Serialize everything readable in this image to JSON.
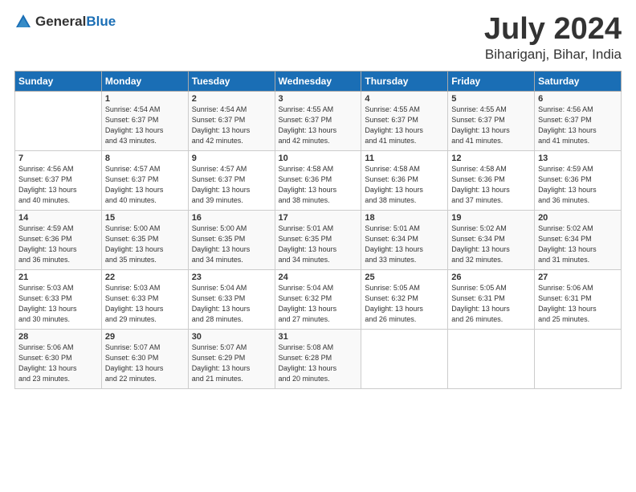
{
  "logo": {
    "text_general": "General",
    "text_blue": "Blue"
  },
  "header": {
    "month": "July 2024",
    "location": "Bihariganj, Bihar, India"
  },
  "weekdays": [
    "Sunday",
    "Monday",
    "Tuesday",
    "Wednesday",
    "Thursday",
    "Friday",
    "Saturday"
  ],
  "weeks": [
    [
      {
        "day": "",
        "info": ""
      },
      {
        "day": "1",
        "info": "Sunrise: 4:54 AM\nSunset: 6:37 PM\nDaylight: 13 hours\nand 43 minutes."
      },
      {
        "day": "2",
        "info": "Sunrise: 4:54 AM\nSunset: 6:37 PM\nDaylight: 13 hours\nand 42 minutes."
      },
      {
        "day": "3",
        "info": "Sunrise: 4:55 AM\nSunset: 6:37 PM\nDaylight: 13 hours\nand 42 minutes."
      },
      {
        "day": "4",
        "info": "Sunrise: 4:55 AM\nSunset: 6:37 PM\nDaylight: 13 hours\nand 41 minutes."
      },
      {
        "day": "5",
        "info": "Sunrise: 4:55 AM\nSunset: 6:37 PM\nDaylight: 13 hours\nand 41 minutes."
      },
      {
        "day": "6",
        "info": "Sunrise: 4:56 AM\nSunset: 6:37 PM\nDaylight: 13 hours\nand 41 minutes."
      }
    ],
    [
      {
        "day": "7",
        "info": "Sunrise: 4:56 AM\nSunset: 6:37 PM\nDaylight: 13 hours\nand 40 minutes."
      },
      {
        "day": "8",
        "info": "Sunrise: 4:57 AM\nSunset: 6:37 PM\nDaylight: 13 hours\nand 40 minutes."
      },
      {
        "day": "9",
        "info": "Sunrise: 4:57 AM\nSunset: 6:37 PM\nDaylight: 13 hours\nand 39 minutes."
      },
      {
        "day": "10",
        "info": "Sunrise: 4:58 AM\nSunset: 6:36 PM\nDaylight: 13 hours\nand 38 minutes."
      },
      {
        "day": "11",
        "info": "Sunrise: 4:58 AM\nSunset: 6:36 PM\nDaylight: 13 hours\nand 38 minutes."
      },
      {
        "day": "12",
        "info": "Sunrise: 4:58 AM\nSunset: 6:36 PM\nDaylight: 13 hours\nand 37 minutes."
      },
      {
        "day": "13",
        "info": "Sunrise: 4:59 AM\nSunset: 6:36 PM\nDaylight: 13 hours\nand 36 minutes."
      }
    ],
    [
      {
        "day": "14",
        "info": "Sunrise: 4:59 AM\nSunset: 6:36 PM\nDaylight: 13 hours\nand 36 minutes."
      },
      {
        "day": "15",
        "info": "Sunrise: 5:00 AM\nSunset: 6:35 PM\nDaylight: 13 hours\nand 35 minutes."
      },
      {
        "day": "16",
        "info": "Sunrise: 5:00 AM\nSunset: 6:35 PM\nDaylight: 13 hours\nand 34 minutes."
      },
      {
        "day": "17",
        "info": "Sunrise: 5:01 AM\nSunset: 6:35 PM\nDaylight: 13 hours\nand 34 minutes."
      },
      {
        "day": "18",
        "info": "Sunrise: 5:01 AM\nSunset: 6:34 PM\nDaylight: 13 hours\nand 33 minutes."
      },
      {
        "day": "19",
        "info": "Sunrise: 5:02 AM\nSunset: 6:34 PM\nDaylight: 13 hours\nand 32 minutes."
      },
      {
        "day": "20",
        "info": "Sunrise: 5:02 AM\nSunset: 6:34 PM\nDaylight: 13 hours\nand 31 minutes."
      }
    ],
    [
      {
        "day": "21",
        "info": "Sunrise: 5:03 AM\nSunset: 6:33 PM\nDaylight: 13 hours\nand 30 minutes."
      },
      {
        "day": "22",
        "info": "Sunrise: 5:03 AM\nSunset: 6:33 PM\nDaylight: 13 hours\nand 29 minutes."
      },
      {
        "day": "23",
        "info": "Sunrise: 5:04 AM\nSunset: 6:33 PM\nDaylight: 13 hours\nand 28 minutes."
      },
      {
        "day": "24",
        "info": "Sunrise: 5:04 AM\nSunset: 6:32 PM\nDaylight: 13 hours\nand 27 minutes."
      },
      {
        "day": "25",
        "info": "Sunrise: 5:05 AM\nSunset: 6:32 PM\nDaylight: 13 hours\nand 26 minutes."
      },
      {
        "day": "26",
        "info": "Sunrise: 5:05 AM\nSunset: 6:31 PM\nDaylight: 13 hours\nand 26 minutes."
      },
      {
        "day": "27",
        "info": "Sunrise: 5:06 AM\nSunset: 6:31 PM\nDaylight: 13 hours\nand 25 minutes."
      }
    ],
    [
      {
        "day": "28",
        "info": "Sunrise: 5:06 AM\nSunset: 6:30 PM\nDaylight: 13 hours\nand 23 minutes."
      },
      {
        "day": "29",
        "info": "Sunrise: 5:07 AM\nSunset: 6:30 PM\nDaylight: 13 hours\nand 22 minutes."
      },
      {
        "day": "30",
        "info": "Sunrise: 5:07 AM\nSunset: 6:29 PM\nDaylight: 13 hours\nand 21 minutes."
      },
      {
        "day": "31",
        "info": "Sunrise: 5:08 AM\nSunset: 6:28 PM\nDaylight: 13 hours\nand 20 minutes."
      },
      {
        "day": "",
        "info": ""
      },
      {
        "day": "",
        "info": ""
      },
      {
        "day": "",
        "info": ""
      }
    ]
  ]
}
